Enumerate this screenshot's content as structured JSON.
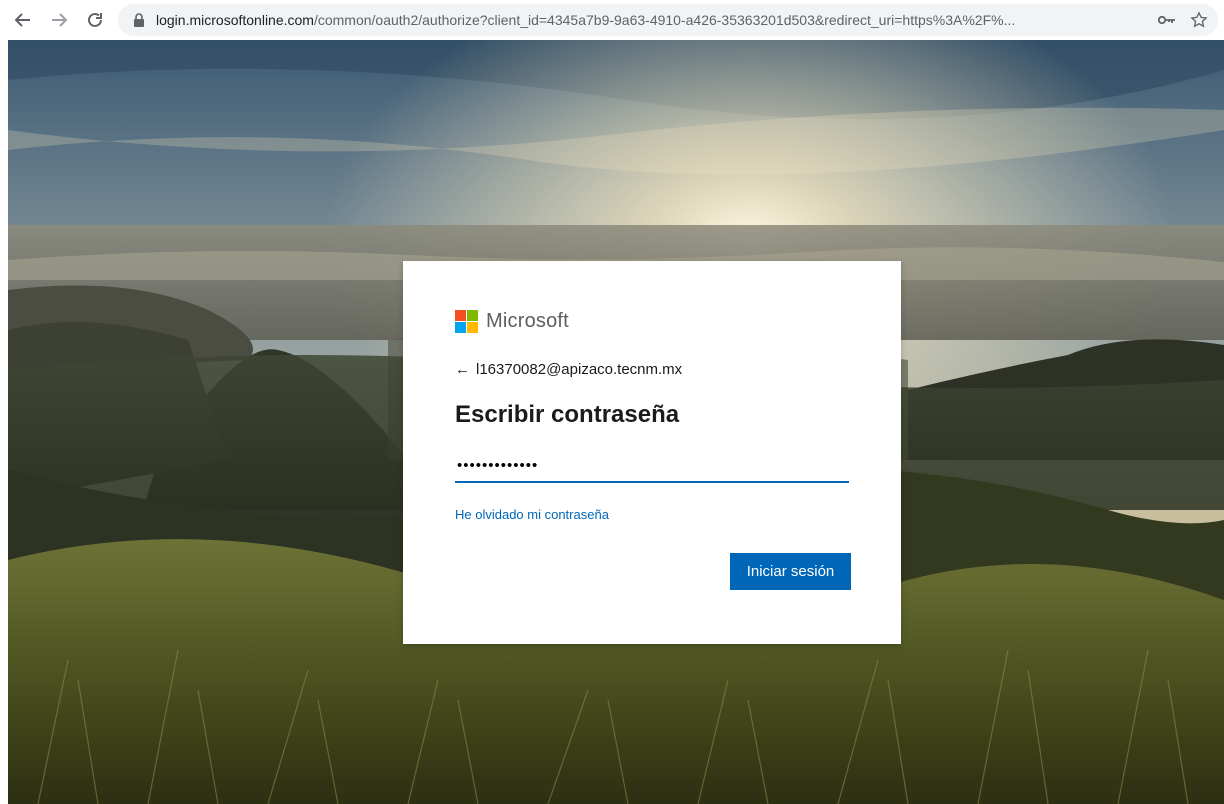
{
  "browser": {
    "url_host": "login.microsoftonline.com",
    "url_rest": "/common/oauth2/authorize?client_id=4345a7b9-9a63-4910-a426-35363201d503&redirect_uri=https%3A%2F%...",
    "icons": {
      "back": "back-arrow-icon",
      "forward": "forward-arrow-icon",
      "reload": "reload-icon",
      "lock": "lock-icon",
      "key": "key-icon",
      "bookmark": "star-icon"
    }
  },
  "login": {
    "brand": "Microsoft",
    "brand_colors": [
      "#f25022",
      "#7fba00",
      "#00a4ef",
      "#ffb900"
    ],
    "identity": "l16370082@apizaco.tecnm.mx",
    "heading": "Escribir contraseña",
    "password_value": "•••••••••••••",
    "forgot_link": "He olvidado mi contraseña",
    "signin_button": "Iniciar sesión",
    "accent_color": "#0067b8"
  }
}
